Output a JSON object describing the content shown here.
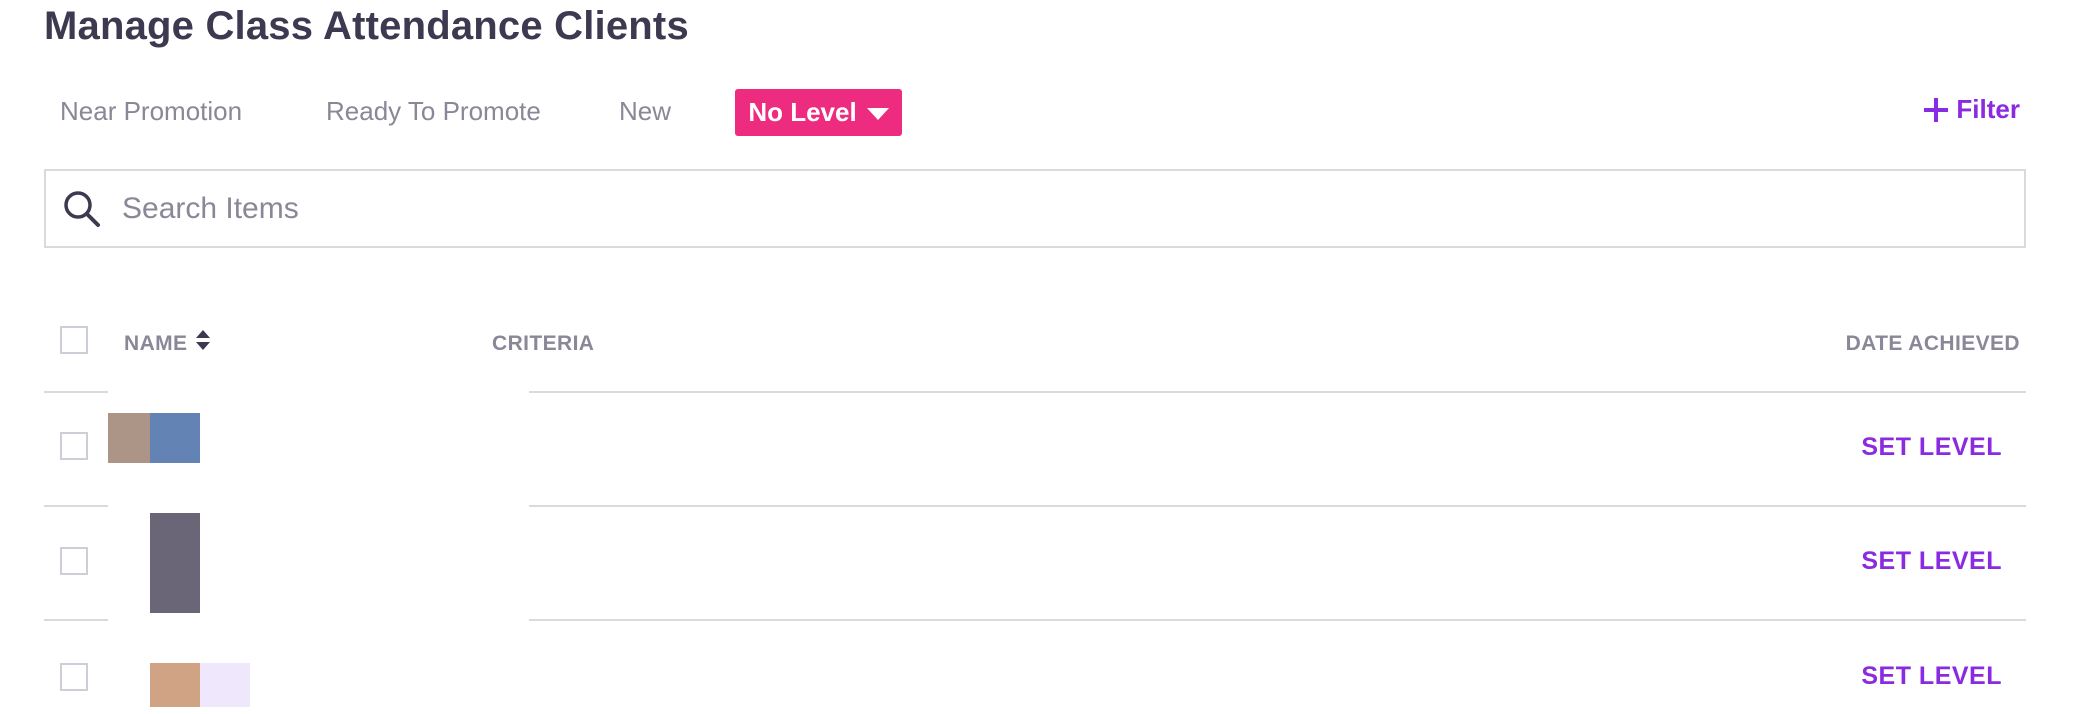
{
  "page": {
    "title": "Manage Class Attendance Clients"
  },
  "tabs": [
    {
      "label": "Near Promotion",
      "active": false
    },
    {
      "label": "Ready To Promote",
      "active": false
    },
    {
      "label": "New",
      "active": false
    },
    {
      "label": "No Level",
      "active": true
    }
  ],
  "filter": {
    "label": "Filter",
    "icon": "plus-icon"
  },
  "search": {
    "placeholder": "Search Items",
    "value": "",
    "icon": "search-icon"
  },
  "table": {
    "columns": {
      "name": "NAME",
      "criteria": "CRITERIA",
      "date_achieved": "DATE ACHIEVED"
    },
    "rows": [
      {
        "action": "SET LEVEL",
        "avatar_colors": [
          "#ac9486",
          "#6383b5"
        ]
      },
      {
        "action": "SET LEVEL",
        "avatar_colors": [
          "#6a6577"
        ]
      },
      {
        "action": "SET LEVEL",
        "avatar_colors": [
          "#cfa384",
          "#efe7fb"
        ]
      }
    ]
  },
  "colors": {
    "accent": "#8a2be2",
    "active_tab": "#ee2c7f",
    "text_primary": "#3d3950",
    "text_muted": "#8a8797"
  }
}
